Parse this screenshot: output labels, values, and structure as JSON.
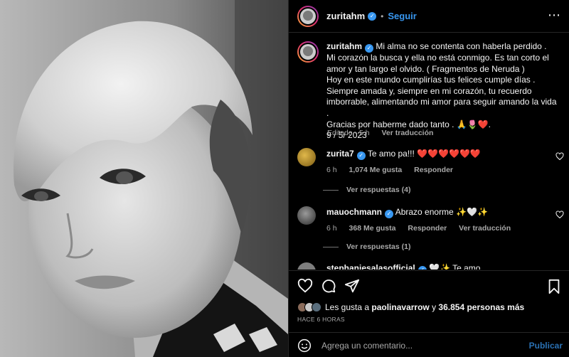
{
  "post": {
    "username": "zuritahm",
    "dot": "•",
    "follow_label": "Seguir",
    "more_label": "⋯"
  },
  "caption": {
    "username": "zuritahm",
    "text": "Mi alma no se contenta con haberla perdido . Mi corazón la busca y ella no está conmigo. Es tan corto el amor y tan largo el olvido. ( Fragmentos de Neruda )\nHoy en este mundo cumplirías tus felices cumple días .\nSiempre amada y, siempre en mi corazón, tu recuerdo imborrable, alimentando mi amor para seguir amando la vida .\nGracias por haberme dado tanto . 🙏🌷❤️.\n9 / 5/ 2023",
    "edited": "Editado · 5 h",
    "translate": "Ver traducción"
  },
  "comments": [
    {
      "username": "zurita7",
      "text": "Te amo pa!!! ",
      "hearts": "❤️❤️❤️❤️❤️❤️",
      "time": "6 h",
      "likes": "1,074 Me gusta",
      "reply": "Responder",
      "translate": "",
      "replies": "Ver respuestas (4)"
    },
    {
      "username": "mauochmann",
      "text": "Abrazo enorme ✨🤍✨",
      "hearts": "",
      "time": "6 h",
      "likes": "368 Me gusta",
      "reply": "Responder",
      "translate": "Ver traducción",
      "replies": "Ver respuestas (1)"
    },
    {
      "username": "stephaniesalasofficial",
      "text": "🤍✨ Te amo",
      "hearts": "",
      "time": "",
      "likes": "",
      "reply": "",
      "translate": "",
      "replies": ""
    }
  ],
  "likes": {
    "prefix": "Les gusta a ",
    "user": "paolinavarrow",
    "middle": " y ",
    "count": "36.854 personas más"
  },
  "time_ago": "HACE 6 HORAS",
  "composer": {
    "placeholder": "Agrega un comentario...",
    "publish": "Publicar"
  },
  "colors": {
    "accent": "#3897f0",
    "background": "#000000",
    "heart": "#ed4956"
  }
}
